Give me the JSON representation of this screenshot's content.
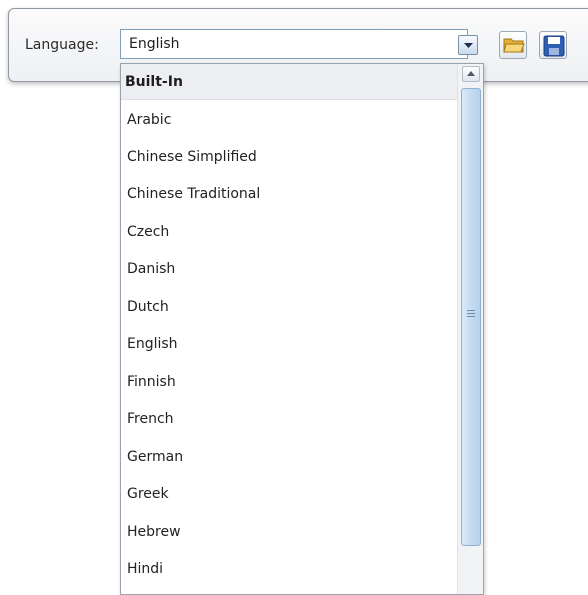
{
  "toolbar": {
    "language_label": "Language:",
    "selected_language": "English",
    "open_icon": "folder-open-icon",
    "save_icon": "save-disk-icon"
  },
  "dropdown": {
    "group_header": "Built-In",
    "items": [
      "Arabic",
      "Chinese Simplified",
      "Chinese Traditional",
      "Czech",
      "Danish",
      "Dutch",
      "English",
      "Finnish",
      "French",
      "German",
      "Greek",
      "Hebrew",
      "Hindi"
    ]
  },
  "colors": {
    "border_blue": "#7f9db9",
    "scroll_thumb": "#c4dbf1",
    "folder_yellow": "#f2c14e",
    "save_blue": "#2f5fb5"
  }
}
